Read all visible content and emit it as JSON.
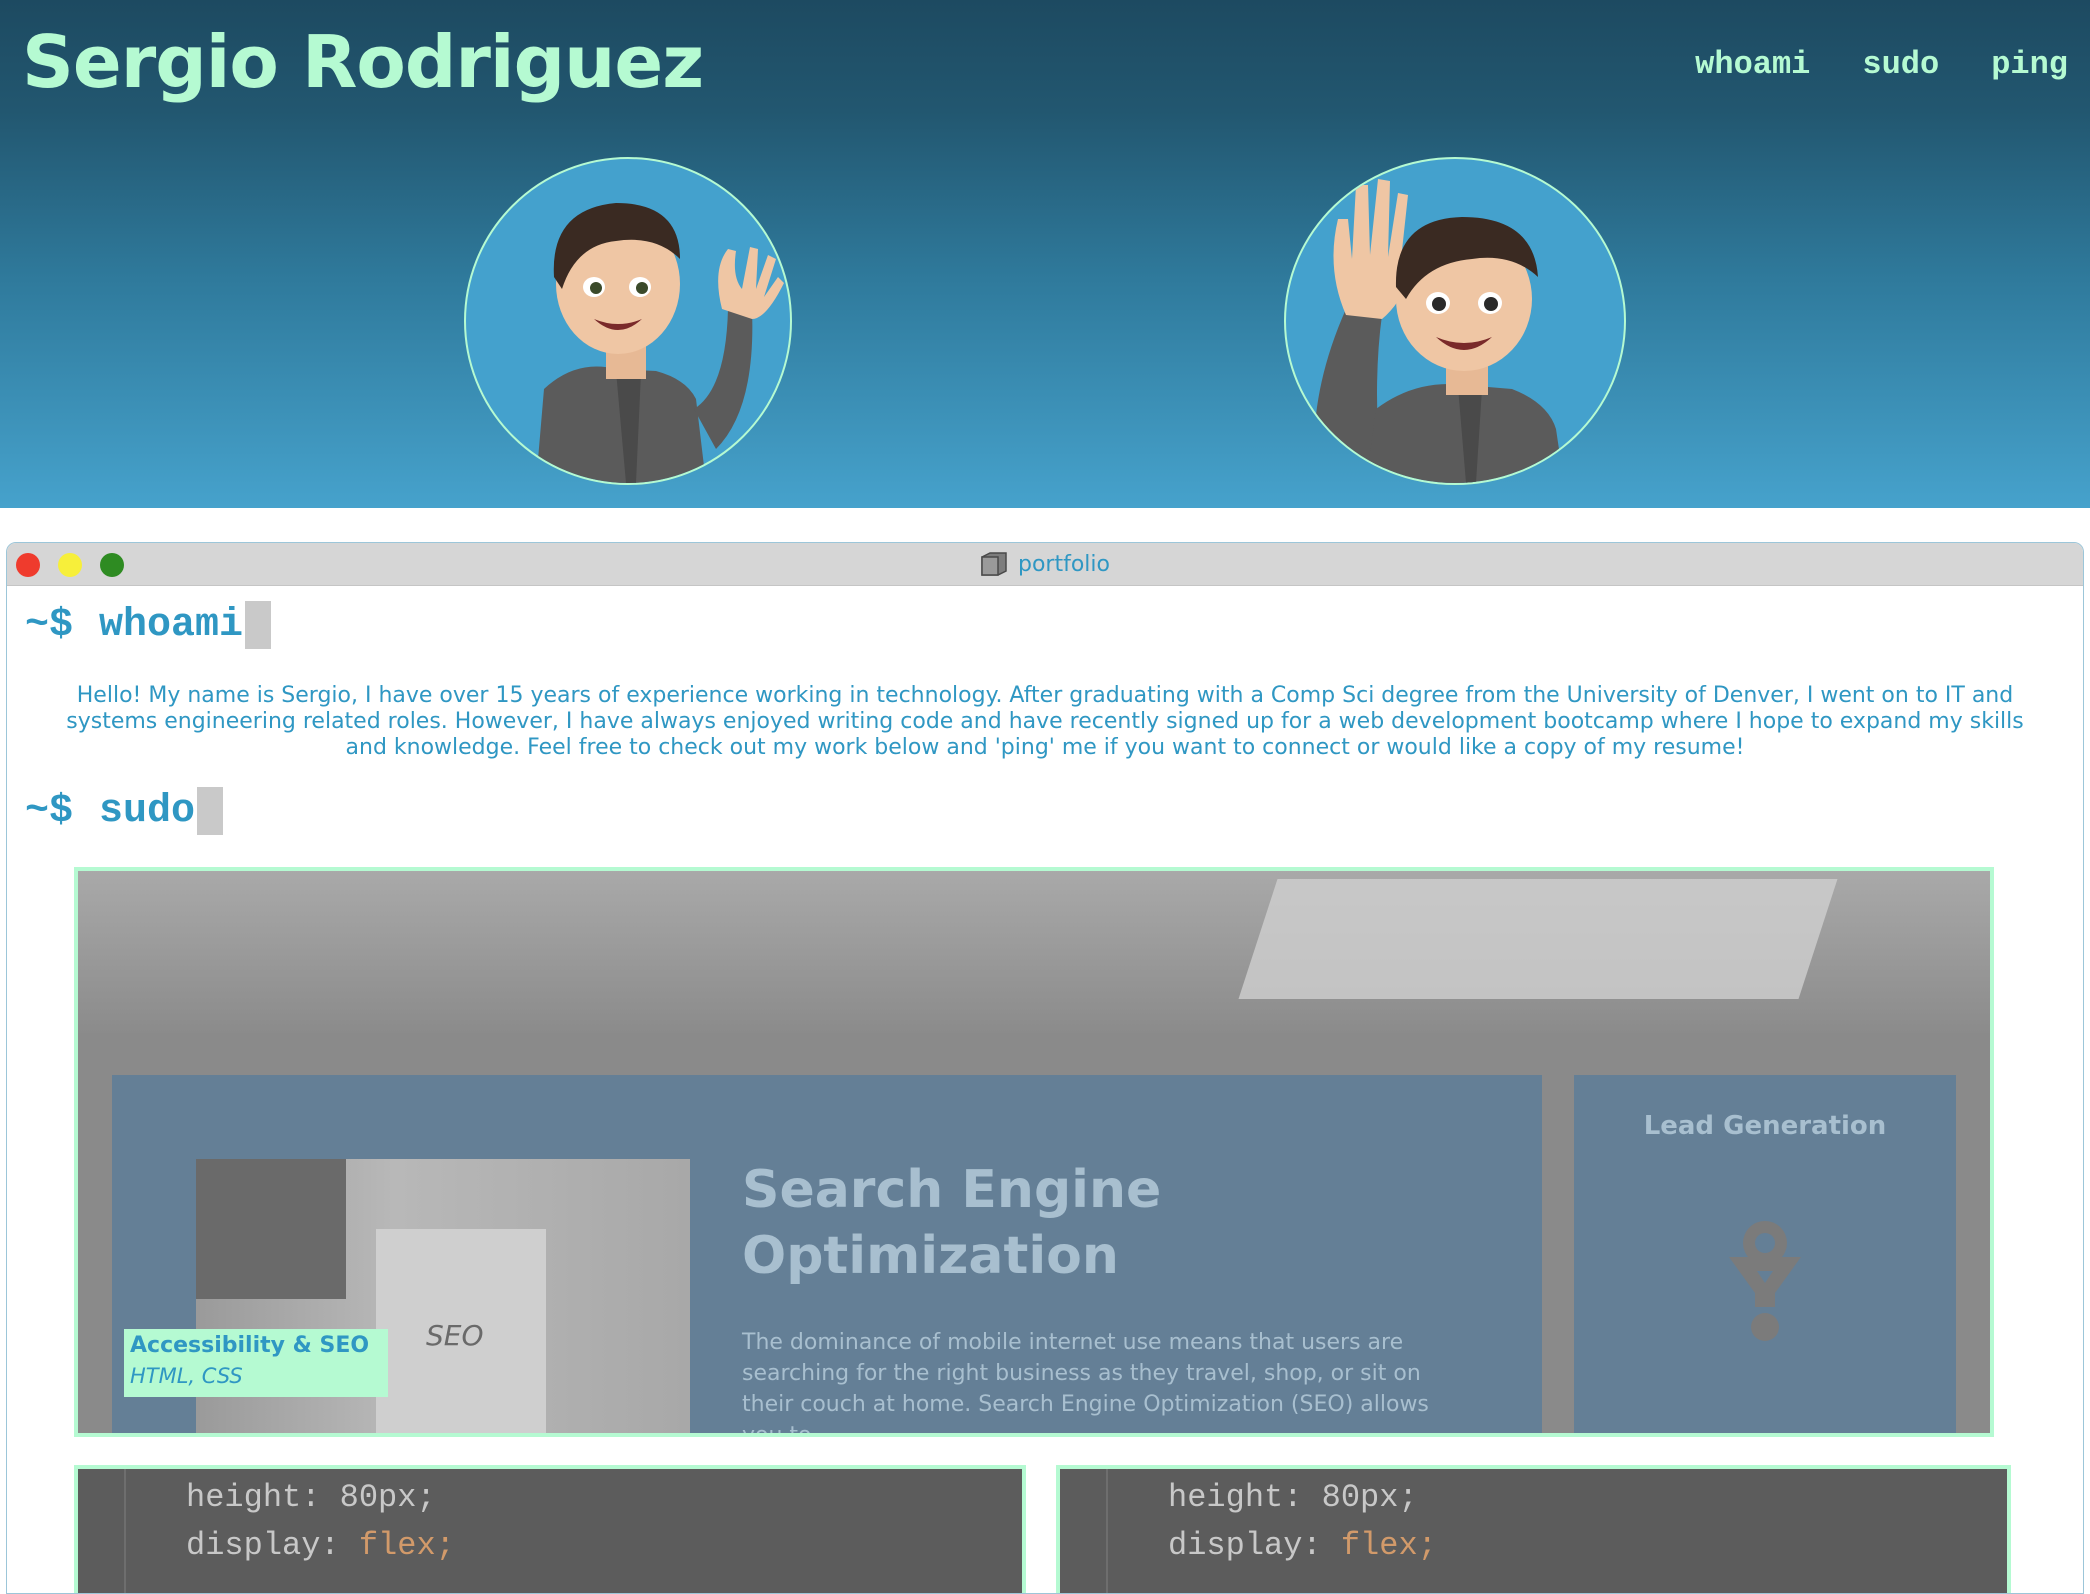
{
  "header": {
    "site_title": "Sergio Rodriguez",
    "nav": [
      "whoami",
      "sudo",
      "ping"
    ]
  },
  "terminal": {
    "title": "portfolio",
    "prompt_symbol": "~$",
    "whoami_command": "whoami",
    "sudo_command": "sudo",
    "bio": "Hello! My name is Sergio, I have over 15 years of experience working in technology. After graduating with a Comp Sci degree from the University of Denver, I went on to IT and systems engineering related roles. However, I have always enjoyed writing code and have recently signed up for a web development bootcamp where I hope to expand my skills and knowledge. Feel free to check out my work below and 'ping' me if you want to connect or would like a copy of my resume!"
  },
  "projects": {
    "main": {
      "screenshot_heading": "Search Engine Optimization",
      "screenshot_text": "The dominance of mobile internet use means that users are searching for the right business as they travel, shop, or sit on their couch at home. Search Engine Optimization (SEO) allows you to",
      "screenshot_side_title": "Lead Generation",
      "screenshot_seo_word": "SEO",
      "caption_title": "Accessibility & SEO",
      "caption_tech": "HTML, CSS"
    },
    "code_cards": [
      {
        "line1": "height: 80px;",
        "line2_prop": "display: ",
        "line2_val": "flex;"
      },
      {
        "line1": "height: 80px;",
        "line2_prop": "display: ",
        "line2_val": "flex;"
      }
    ]
  },
  "colors": {
    "mint": "#b5fad2",
    "accent_blue": "#2f97c3",
    "header_dark": "#1d4a61",
    "header_light": "#46a2cc"
  },
  "icons": [
    "folder-icon",
    "funnel-gear-icon",
    "avatar-waving-left",
    "avatar-waving-right"
  ]
}
